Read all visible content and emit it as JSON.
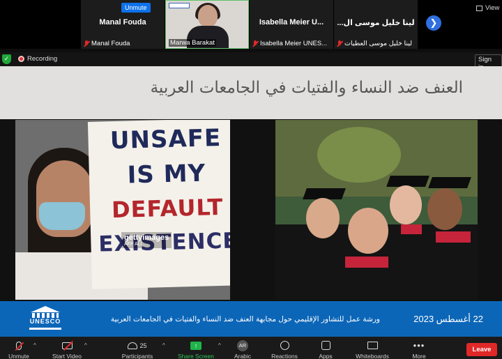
{
  "participants": [
    {
      "name_big": "Manal Fouda",
      "name_small": "Manal Fouda",
      "muted": true,
      "unmute_label": "Unmute"
    },
    {
      "name_small": "Marwa Barakat",
      "muted": false,
      "active_speaker": true
    },
    {
      "name_big": "Isabella Meier U...",
      "name_small": "Isabella Meier UNES...",
      "muted": true
    },
    {
      "name_big": "لينا خليل موسى  ال...",
      "name_small": "لينا خليل موسى  العطيات",
      "muted": true
    }
  ],
  "strip": {
    "view_label": "View",
    "next_icon": "chevron-right-icon"
  },
  "status": {
    "recording_label": "Recording",
    "sign_in_label": "Sign in",
    "security_icon": "shield-check-icon"
  },
  "slide": {
    "title": "العنف ضد النساء والفتيات في الجامعات العربية",
    "sign_lines": [
      "UNSAFE",
      "IS MY",
      "DEFAULT",
      "EXISTENCE"
    ],
    "watermark": "gettyimages",
    "watermark_credit": "AFP ALI",
    "band_text": "ورشة عمل للتشاور الإقليمي حول مجابهة العنف ضد النساء والفتيات في الجامعات العربية",
    "band_date": "22 أغسطس 2023",
    "logo_text": "UNESCO"
  },
  "toolbar": {
    "unmute": "Unmute",
    "start_video": "Start Video",
    "participants": "Participants",
    "participants_count": "25",
    "share_screen": "Share Screen",
    "arabic": "Arabic",
    "arabic_badge": "AR",
    "reactions": "Reactions",
    "apps": "Apps",
    "whiteboards": "Whiteboards",
    "more": "More",
    "leave": "Leave"
  },
  "colors": {
    "accent": "#0e71eb",
    "share_green": "#1fb34a",
    "leave_red": "#e02828",
    "band_blue": "#0c66b8"
  }
}
